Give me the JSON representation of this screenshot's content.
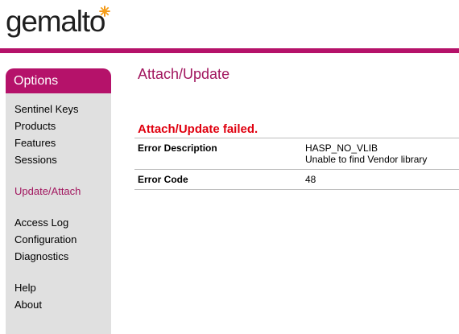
{
  "brand": {
    "logo_text": "gemalto",
    "accent_color": "#b5126a",
    "title_color": "#a2175f",
    "error_color": "#e0000f"
  },
  "sidebar": {
    "header": "Options",
    "items": [
      {
        "label": "Sentinel Keys",
        "active": false
      },
      {
        "label": "Products",
        "active": false
      },
      {
        "label": "Features",
        "active": false
      },
      {
        "label": "Sessions",
        "active": false
      },
      {
        "label": "Update/Attach",
        "active": true
      },
      {
        "label": "Access Log",
        "active": false
      },
      {
        "label": "Configuration",
        "active": false
      },
      {
        "label": "Diagnostics",
        "active": false
      },
      {
        "label": "Help",
        "active": false
      },
      {
        "label": "About",
        "active": false
      }
    ]
  },
  "main": {
    "title": "Attach/Update",
    "error_heading": "Attach/Update failed.",
    "rows": [
      {
        "label": "Error Description",
        "value_lines": [
          "HASP_NO_VLIB",
          "Unable to find Vendor library"
        ]
      },
      {
        "label": "Error Code",
        "value_lines": [
          "48"
        ]
      }
    ]
  }
}
